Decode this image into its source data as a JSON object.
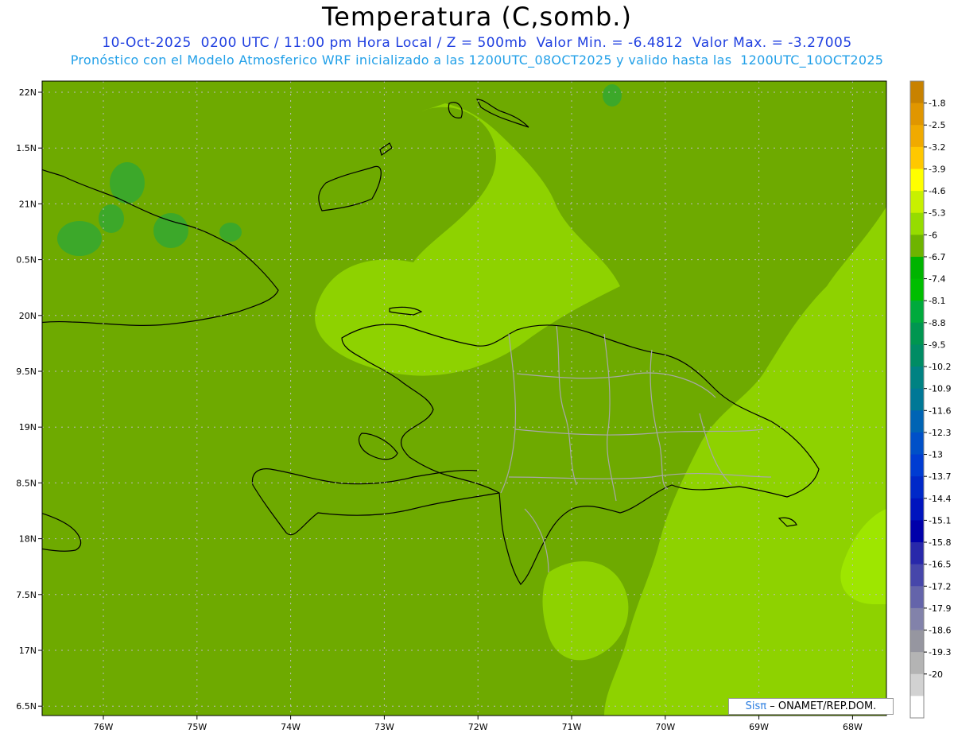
{
  "header": {
    "title": "Temperatura (C,somb.)",
    "subtitle": "10-Oct-2025  0200 UTC / 11:00 pm Hora Local / Z = 500mb  Valor Min. = -6.4812  Valor Max. = -3.27005",
    "description": "Pronóstico con el Modelo Atmosferico WRF inicializado a las 1200UTC_08OCT2025 y valido hasta las  1200UTC_10OCT2025"
  },
  "axes": {
    "lat_labels": [
      "22N",
      "1.5N",
      "21N",
      "0.5N",
      "20N",
      "9.5N",
      "19N",
      "8.5N",
      "18N",
      "7.5N",
      "17N",
      "6.5N"
    ],
    "lon_labels": [
      "76W",
      "75W",
      "74W",
      "73W",
      "72W",
      "71W",
      "70W",
      "69W",
      "68W"
    ]
  },
  "colorbar": {
    "labels": [
      "-1.8",
      "-2.5",
      "-3.2",
      "-3.9",
      "-4.6",
      "-5.3",
      "-6",
      "-6.7",
      "-7.4",
      "-8.1",
      "-8.8",
      "-9.5",
      "-10.2",
      "-10.9",
      "-11.6",
      "-12.3",
      "-13",
      "-13.7",
      "-14.4",
      "-15.1",
      "-15.8",
      "-16.5",
      "-17.2",
      "-17.9",
      "-18.6",
      "-19.3",
      "-20"
    ],
    "colors": [
      "#c88200",
      "#e09600",
      "#f0aa00",
      "#ffc800",
      "#ffff00",
      "#c8f000",
      "#96dc00",
      "#6eb400",
      "#00b400",
      "#00be00",
      "#00aa3c",
      "#009650",
      "#008c64",
      "#008282",
      "#007896",
      "#0064b4",
      "#0050c8",
      "#003cd2",
      "#0028c8",
      "#0014be",
      "#0000aa",
      "#2828aa",
      "#4646aa",
      "#6464aa",
      "#8282aa",
      "#9696a0",
      "#b4b4b4",
      "#d2d2d2",
      "#ffffff"
    ]
  },
  "credit": {
    "logo": "Sisπ",
    "text": "– ONAMET/REP.DOM."
  },
  "map_colors": {
    "base": "#6eaa00",
    "light": "#8ed200",
    "lighter": "#9ee600",
    "darkgreen": "#3ca82a",
    "coast": "#000000",
    "provinces": "#a8a8a8",
    "grid": "#bbbbbb"
  }
}
